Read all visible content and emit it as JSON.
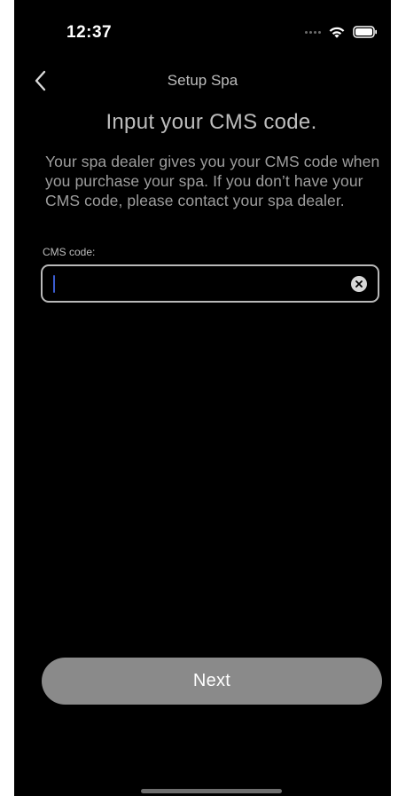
{
  "status_bar": {
    "time": "12:37"
  },
  "nav": {
    "title": "Setup Spa",
    "back_icon": "chevron-left-icon"
  },
  "main": {
    "heading": "Input your CMS code.",
    "description": "Your spa dealer gives you your CMS code when you purchase your spa. If you don’t have your CMS code, please contact your spa dealer.",
    "cms_field": {
      "label": "CMS code:",
      "value": "",
      "placeholder": ""
    }
  },
  "footer": {
    "next_label": "Next"
  },
  "colors": {
    "background": "#000000",
    "text_secondary": "#bdbdbd",
    "button_disabled": "#8a8a8a",
    "caret": "#3b5ccf"
  }
}
